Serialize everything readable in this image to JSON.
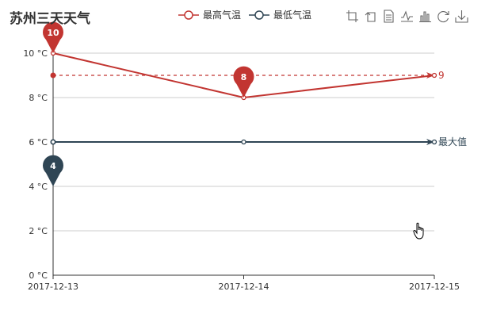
{
  "title": "苏州三天天气",
  "legend": [
    {
      "label": "最高气温",
      "color": "#c23531"
    },
    {
      "label": "最低气温",
      "color": "#2f4554"
    }
  ],
  "toolbox": [
    {
      "icon": "data-zoom-icon"
    },
    {
      "icon": "zoom-reset-icon"
    },
    {
      "icon": "data-view-icon"
    },
    {
      "icon": "line-chart-icon"
    },
    {
      "icon": "bar-chart-icon"
    },
    {
      "icon": "restore-icon"
    },
    {
      "icon": "save-image-icon"
    }
  ],
  "chart_data": {
    "type": "line",
    "title": "苏州三天天气",
    "categories": [
      "2017-12-13",
      "2017-12-14",
      "2017-12-15"
    ],
    "y_ticks": [
      "0 °C",
      "2 °C",
      "4 °C",
      "6 °C",
      "8 °C",
      "10 °C"
    ],
    "ylim": [
      0,
      10
    ],
    "grid": true,
    "legend_position": "top",
    "series": [
      {
        "name": "最高气温",
        "color": "#c23531",
        "values": [
          10,
          8,
          9
        ],
        "mark_points": [
          {
            "category": "2017-12-13",
            "value": 10,
            "label": "10"
          },
          {
            "category": "2017-12-14",
            "value": 8,
            "label": "8"
          }
        ],
        "mark_line": {
          "value": 9,
          "label": "9",
          "style": "dashed"
        }
      },
      {
        "name": "最低气温",
        "color": "#2f4554",
        "values": [
          6,
          6,
          6
        ],
        "mark_points": [
          {
            "category": "2017-12-13",
            "value": 4,
            "label": "4"
          }
        ],
        "mark_line": {
          "value": 6,
          "label": "最大值",
          "style": "solid"
        }
      }
    ]
  }
}
